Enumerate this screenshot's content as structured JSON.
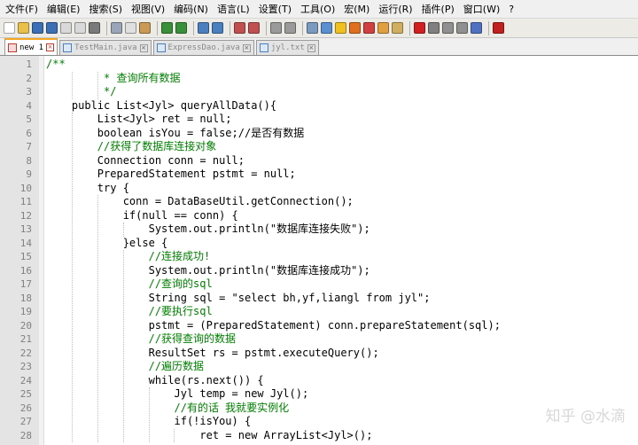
{
  "menu": [
    "文件(F)",
    "编辑(E)",
    "搜索(S)",
    "视图(V)",
    "编码(N)",
    "语言(L)",
    "设置(T)",
    "工具(O)",
    "宏(M)",
    "运行(R)",
    "插件(P)",
    "窗口(W)",
    "?"
  ],
  "toolbar_icons": [
    {
      "name": "new-file-icon",
      "color": "#ffffff"
    },
    {
      "name": "open-file-icon",
      "color": "#e8c04a"
    },
    {
      "name": "save-icon",
      "color": "#3c6fb5"
    },
    {
      "name": "save-all-icon",
      "color": "#3c6fb5"
    },
    {
      "name": "close-icon",
      "color": "#d9d9d9"
    },
    {
      "name": "close-all-icon",
      "color": "#d9d9d9"
    },
    {
      "name": "print-icon",
      "color": "#7a7a7a"
    },
    {
      "sep": true
    },
    {
      "name": "cut-icon",
      "color": "#9aa6b8"
    },
    {
      "name": "copy-icon",
      "color": "#e0e0e0"
    },
    {
      "name": "paste-icon",
      "color": "#c99a55"
    },
    {
      "sep": true
    },
    {
      "name": "undo-icon",
      "color": "#3a8f3a"
    },
    {
      "name": "redo-icon",
      "color": "#3a8f3a"
    },
    {
      "sep": true
    },
    {
      "name": "find-icon",
      "color": "#4a80c0"
    },
    {
      "name": "replace-icon",
      "color": "#4a80c0"
    },
    {
      "sep": true
    },
    {
      "name": "zoom-in-icon",
      "color": "#c05050"
    },
    {
      "name": "zoom-out-icon",
      "color": "#c05050"
    },
    {
      "sep": true
    },
    {
      "name": "sync-v-scroll-icon",
      "color": "#9a9a9a"
    },
    {
      "name": "sync-h-scroll-icon",
      "color": "#9a9a9a"
    },
    {
      "sep": true
    },
    {
      "name": "word-wrap-icon",
      "color": "#7a9abf"
    },
    {
      "name": "show-all-chars-icon",
      "color": "#5a8fd0"
    },
    {
      "name": "indent-guide-icon",
      "color": "#f0c020"
    },
    {
      "name": "user-lang-icon",
      "color": "#e07020"
    },
    {
      "name": "doc-map-icon",
      "color": "#d04040"
    },
    {
      "name": "function-list-icon",
      "color": "#e0a040"
    },
    {
      "name": "folder-workspace-icon",
      "color": "#d0b060"
    },
    {
      "sep": true
    },
    {
      "name": "record-macro-icon",
      "color": "#d02020"
    },
    {
      "name": "stop-macro-icon",
      "color": "#808080"
    },
    {
      "name": "play-macro-icon",
      "color": "#909090"
    },
    {
      "name": "run-macro-multiple-icon",
      "color": "#909090"
    },
    {
      "name": "save-macro-icon",
      "color": "#5070c0"
    },
    {
      "sep": true
    },
    {
      "name": "spell-check-icon",
      "color": "#c02020"
    }
  ],
  "tabs": [
    {
      "label": "new 1",
      "active": true
    },
    {
      "label": "TestMain.java",
      "active": false
    },
    {
      "label": "ExpressDao.java",
      "active": false
    },
    {
      "label": "jyl.txt",
      "active": false
    }
  ],
  "code_lines": [
    {
      "n": "1",
      "text": "/**"
    },
    {
      "n": "2",
      "text": "         * 查询所有数据"
    },
    {
      "n": "3",
      "text": "         */"
    },
    {
      "n": "4",
      "text": "    public List<Jyl> queryAllData(){"
    },
    {
      "n": "5",
      "text": "        List<Jyl> ret = null;"
    },
    {
      "n": "6",
      "text": "        boolean isYou = false;//是否有数据"
    },
    {
      "n": "7",
      "text": "        //获得了数据库连接对象"
    },
    {
      "n": "8",
      "text": "        Connection conn = null;"
    },
    {
      "n": "9",
      "text": "        PreparedStatement pstmt = null;"
    },
    {
      "n": "10",
      "text": "        try {"
    },
    {
      "n": "11",
      "text": "            conn = DataBaseUtil.getConnection();"
    },
    {
      "n": "12",
      "text": "            if(null == conn) {"
    },
    {
      "n": "13",
      "text": "                System.out.println(\"数据库连接失败\");"
    },
    {
      "n": "14",
      "text": "            }else {"
    },
    {
      "n": "15",
      "text": "                //连接成功!"
    },
    {
      "n": "16",
      "text": "                System.out.println(\"数据库连接成功\");"
    },
    {
      "n": "17",
      "text": "                //查询的sql"
    },
    {
      "n": "18",
      "text": "                String sql = \"select bh,yf,liangl from jyl\";"
    },
    {
      "n": "19",
      "text": "                //要执行sql"
    },
    {
      "n": "20",
      "text": "                pstmt = (PreparedStatement) conn.prepareStatement(sql);"
    },
    {
      "n": "21",
      "text": "                //获得查询的数据"
    },
    {
      "n": "22",
      "text": "                ResultSet rs = pstmt.executeQuery();"
    },
    {
      "n": "23",
      "text": "                //遍历数据"
    },
    {
      "n": "24",
      "text": "                while(rs.next()) {"
    },
    {
      "n": "25",
      "text": "                    Jyl temp = new Jyl();"
    },
    {
      "n": "26",
      "text": "                    //有的话 我就要实例化"
    },
    {
      "n": "27",
      "text": "                    if(!isYou) {"
    },
    {
      "n": "28",
      "text": "                        ret = new ArrayList<Jyl>();"
    }
  ],
  "watermark": "知乎 @水滴"
}
